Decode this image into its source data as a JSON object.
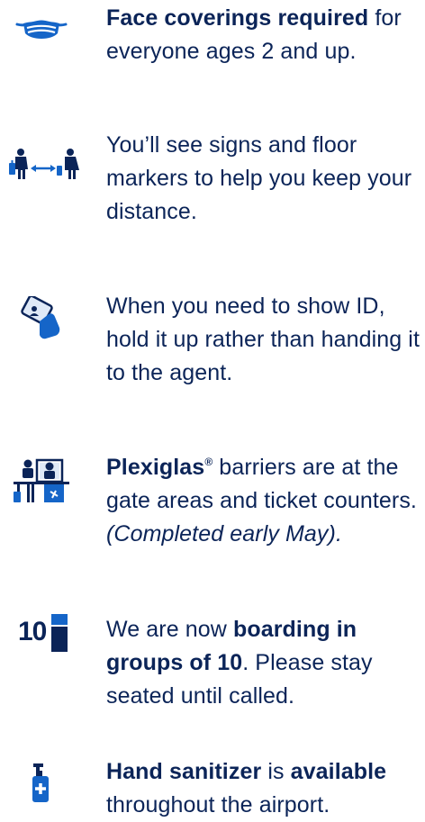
{
  "colors": {
    "navy": "#0b2458",
    "blue": "#1565c8",
    "light_blue": "#dfe9f7"
  },
  "items": [
    {
      "icon": "face-mask-icon",
      "bold1": "Face coverings required",
      "rest1": " for everyone ages 2 and up."
    },
    {
      "icon": "social-distance-icon",
      "text": "You’ll see signs and floor markers to help you keep your distance."
    },
    {
      "icon": "hand-id-card-icon",
      "text": "When you need to show ID, hold it up rather than handing it to the agent."
    },
    {
      "icon": "plexiglas-barrier-icon",
      "bold1": "Plexiglas",
      "reg": "®",
      "rest1": " barriers are at the gate areas and ticket counters. ",
      "italic": "(Completed early May)."
    },
    {
      "icon": "boarding-groups-icon",
      "icon_number": "10",
      "lead": "We are now ",
      "bold1": "boarding in groups of 10",
      "rest1": ". Please stay seated until called."
    },
    {
      "icon": "hand-sanitizer-icon",
      "bold1": "Hand sanitizer",
      "mid": " is ",
      "bold2": "available",
      "rest1": " throughout the airport."
    }
  ]
}
